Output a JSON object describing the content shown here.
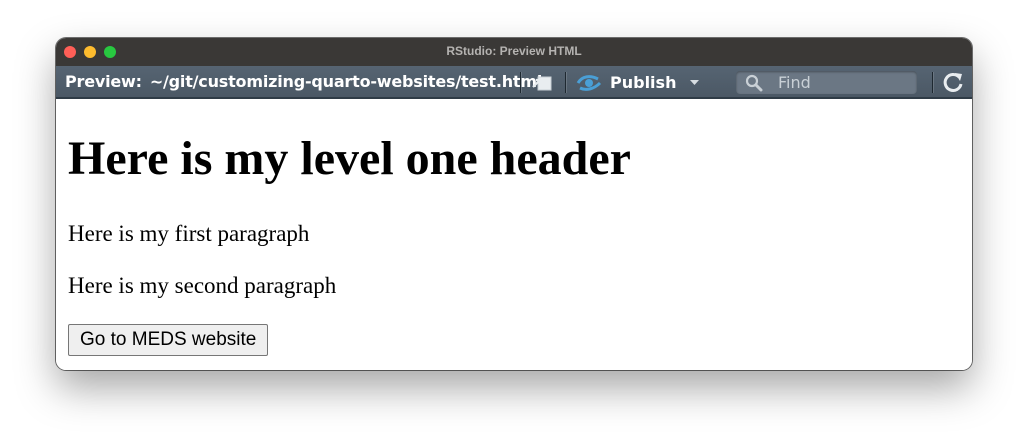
{
  "window": {
    "title": "RStudio: Preview HTML"
  },
  "toolbar": {
    "preview_label": "Preview:",
    "file_path": "~/git/customizing-quarto-websites/test.html",
    "publish_label": "Publish",
    "find_placeholder": "Find",
    "icons": [
      "popout-icon",
      "publish-icon",
      "caret-down-icon",
      "search-icon",
      "refresh-icon"
    ]
  },
  "content": {
    "heading": "Here is my level one header",
    "paragraph_1": "Here is my first paragraph",
    "paragraph_2": "Here is my second paragraph",
    "button_label": "Go to MEDS website"
  },
  "colors": {
    "titlebar": "#3a3836",
    "toolbar": "#4f5c69",
    "publish_accent": "#4a9fd6"
  }
}
